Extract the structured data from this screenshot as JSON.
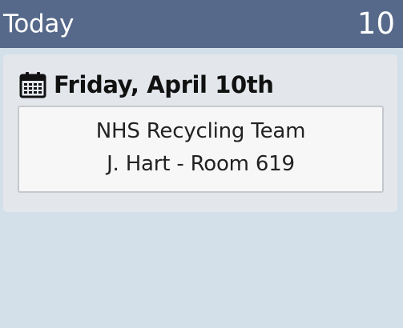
{
  "header": {
    "title": "Today",
    "count": "10"
  },
  "panel": {
    "date_icon": "calendar-icon",
    "date_label": "Friday, April 10th",
    "event": {
      "title": "NHS Recycling Team",
      "subtitle": "J. Hart - Room 619"
    }
  },
  "colors": {
    "header_bg": "#56698a",
    "page_bg": "#d3e0ea",
    "panel_bg": "#e3e7ec",
    "card_bg": "#f7f7f7"
  }
}
